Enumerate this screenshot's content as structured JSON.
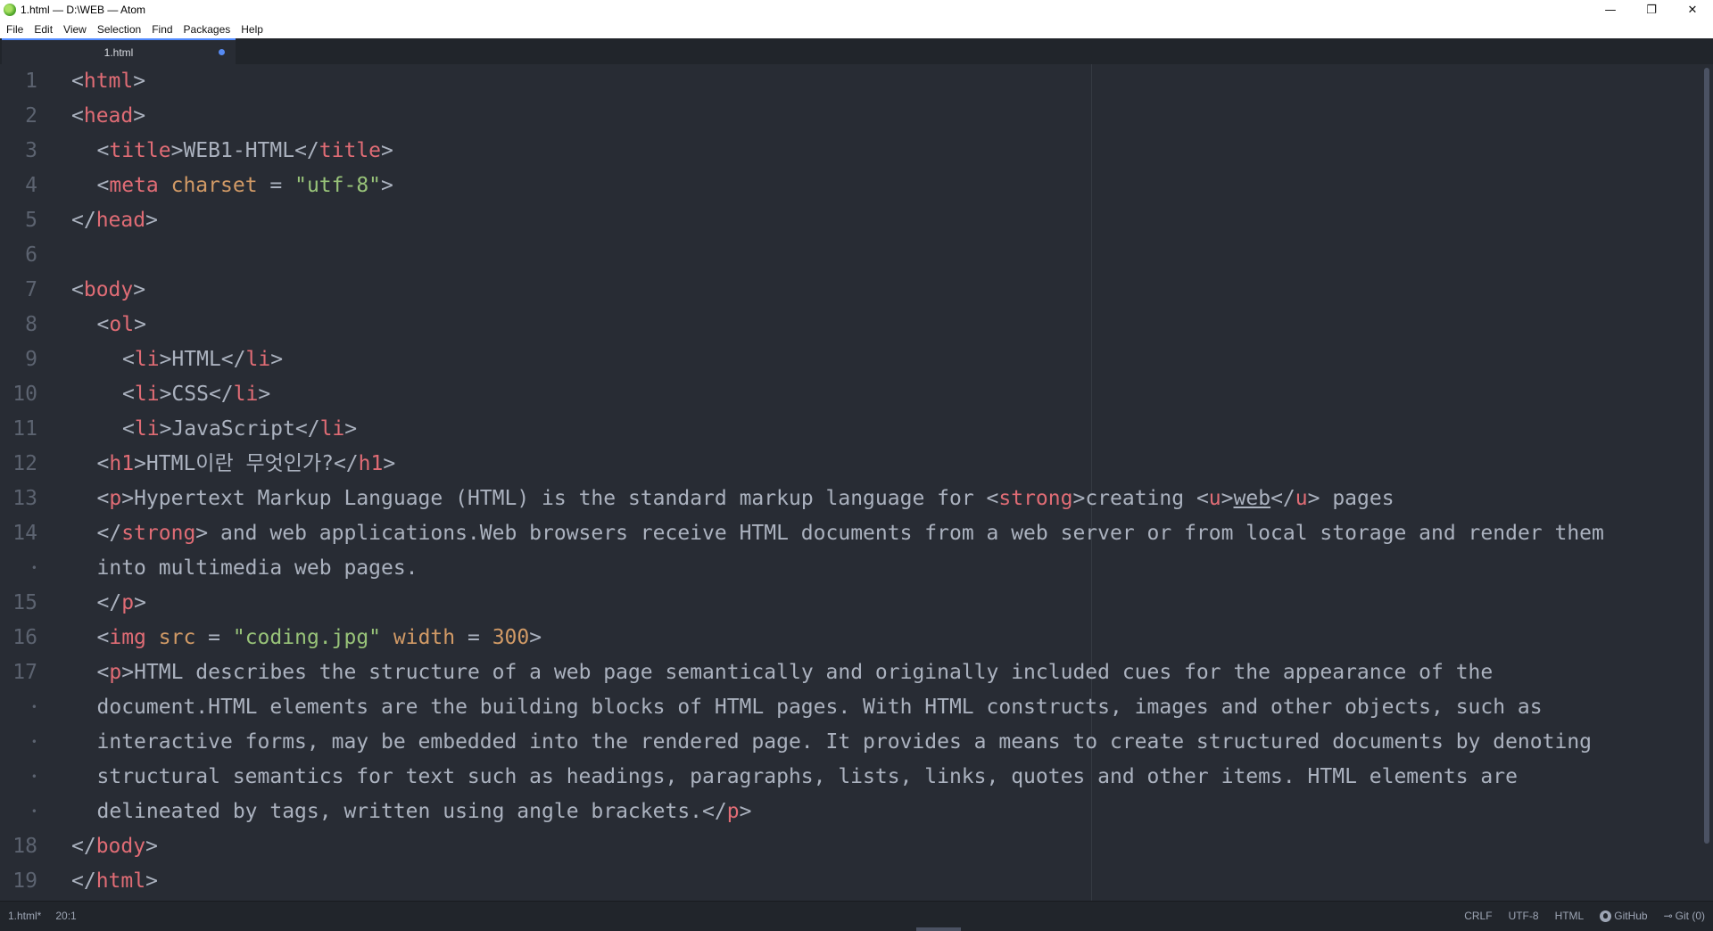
{
  "window": {
    "title": "1.html — D:\\WEB — Atom",
    "controls": {
      "minimize": "—",
      "restore": "❐",
      "close": "✕"
    }
  },
  "menu": [
    "File",
    "Edit",
    "View",
    "Selection",
    "Find",
    "Packages",
    "Help"
  ],
  "tabs": [
    {
      "label": "1.html",
      "modified": true
    }
  ],
  "editor": {
    "lines": [
      {
        "gutter": "1",
        "indent": 0,
        "tokens": [
          [
            "p",
            "<"
          ],
          [
            "tag",
            "html"
          ],
          [
            "p",
            ">"
          ]
        ]
      },
      {
        "gutter": "2",
        "indent": 0,
        "tokens": [
          [
            "p",
            "<"
          ],
          [
            "tag",
            "head"
          ],
          [
            "p",
            ">"
          ]
        ]
      },
      {
        "gutter": "3",
        "indent": 1,
        "tokens": [
          [
            "p",
            "<"
          ],
          [
            "tag",
            "title"
          ],
          [
            "p",
            ">WEB1-HTML</"
          ],
          [
            "tag",
            "title"
          ],
          [
            "p",
            ">"
          ]
        ]
      },
      {
        "gutter": "4",
        "indent": 1,
        "tokens": [
          [
            "p",
            "<"
          ],
          [
            "tag",
            "meta"
          ],
          [
            "p",
            " "
          ],
          [
            "attr",
            "charset"
          ],
          [
            "p",
            " = "
          ],
          [
            "str",
            "\"utf-8\""
          ],
          [
            "p",
            ">"
          ]
        ]
      },
      {
        "gutter": "5",
        "indent": 0,
        "tokens": [
          [
            "p",
            "</"
          ],
          [
            "tag",
            "head"
          ],
          [
            "p",
            ">"
          ]
        ]
      },
      {
        "gutter": "6",
        "indent": 0,
        "tokens": []
      },
      {
        "gutter": "7",
        "indent": 0,
        "tokens": [
          [
            "p",
            "<"
          ],
          [
            "tag",
            "body"
          ],
          [
            "p",
            ">"
          ]
        ]
      },
      {
        "gutter": "8",
        "indent": 1,
        "tokens": [
          [
            "p",
            "<"
          ],
          [
            "tag",
            "ol"
          ],
          [
            "p",
            ">"
          ]
        ]
      },
      {
        "gutter": "9",
        "indent": 2,
        "tokens": [
          [
            "p",
            "<"
          ],
          [
            "tag",
            "li"
          ],
          [
            "p",
            ">HTML</"
          ],
          [
            "tag",
            "li"
          ],
          [
            "p",
            ">"
          ]
        ]
      },
      {
        "gutter": "10",
        "indent": 2,
        "tokens": [
          [
            "p",
            "<"
          ],
          [
            "tag",
            "li"
          ],
          [
            "p",
            ">CSS</"
          ],
          [
            "tag",
            "li"
          ],
          [
            "p",
            ">"
          ]
        ]
      },
      {
        "gutter": "11",
        "indent": 2,
        "tokens": [
          [
            "p",
            "<"
          ],
          [
            "tag",
            "li"
          ],
          [
            "p",
            ">JavaScript</"
          ],
          [
            "tag",
            "li"
          ],
          [
            "p",
            ">"
          ]
        ]
      },
      {
        "gutter": "12",
        "indent": 1,
        "tokens": [
          [
            "p",
            "<"
          ],
          [
            "tag",
            "h1"
          ],
          [
            "p",
            ">HTML이란 무엇인가?</"
          ],
          [
            "tag",
            "h1"
          ],
          [
            "p",
            ">"
          ]
        ]
      },
      {
        "gutter": "13",
        "indent": 1,
        "tokens": [
          [
            "p",
            "<"
          ],
          [
            "tag",
            "p"
          ],
          [
            "p",
            ">Hypertext Markup Language (HTML) is the standard markup language for <"
          ],
          [
            "tag",
            "strong"
          ],
          [
            "p",
            ">creating <"
          ],
          [
            "tag",
            "u"
          ],
          [
            "p",
            ">"
          ],
          [
            "under",
            "web"
          ],
          [
            "p",
            "</"
          ],
          [
            "tag",
            "u"
          ],
          [
            "p",
            "> pages"
          ]
        ]
      },
      {
        "gutter": "14",
        "indent": 1,
        "tokens": [
          [
            "p",
            "</"
          ],
          [
            "tag",
            "strong"
          ],
          [
            "p",
            "> and web applications.Web browsers receive HTML documents from a web server or from local storage and render them"
          ]
        ]
      },
      {
        "gutter": "•",
        "indent": 1,
        "tokens": [
          [
            "p",
            "into multimedia web pages."
          ]
        ]
      },
      {
        "gutter": "15",
        "indent": 1,
        "tokens": [
          [
            "p",
            "</"
          ],
          [
            "tag",
            "p"
          ],
          [
            "p",
            ">"
          ]
        ]
      },
      {
        "gutter": "16",
        "indent": 1,
        "tokens": [
          [
            "p",
            "<"
          ],
          [
            "tag",
            "img"
          ],
          [
            "p",
            " "
          ],
          [
            "attr",
            "src"
          ],
          [
            "p",
            " = "
          ],
          [
            "str",
            "\"coding.jpg\""
          ],
          [
            "p",
            " "
          ],
          [
            "attr",
            "width"
          ],
          [
            "p",
            " = "
          ],
          [
            "num",
            "300"
          ],
          [
            "p",
            ">"
          ]
        ]
      },
      {
        "gutter": "17",
        "indent": 1,
        "tokens": [
          [
            "p",
            "<"
          ],
          [
            "tag",
            "p"
          ],
          [
            "p",
            ">HTML describes the structure of a web page semantically and originally included cues for the appearance of the"
          ]
        ]
      },
      {
        "gutter": "•",
        "indent": 1,
        "tokens": [
          [
            "p",
            "document.HTML elements are the building blocks of HTML pages. With HTML constructs, images and other objects, such as"
          ]
        ]
      },
      {
        "gutter": "•",
        "indent": 1,
        "tokens": [
          [
            "p",
            "interactive forms, may be embedded into the rendered page. It provides a means to create structured documents by denoting"
          ]
        ]
      },
      {
        "gutter": "•",
        "indent": 1,
        "tokens": [
          [
            "p",
            "structural semantics for text such as headings, paragraphs, lists, links, quotes and other items. HTML elements are"
          ]
        ]
      },
      {
        "gutter": "•",
        "indent": 1,
        "tokens": [
          [
            "p",
            "delineated by tags, written using angle brackets.</"
          ],
          [
            "tag",
            "p"
          ],
          [
            "p",
            ">"
          ]
        ]
      },
      {
        "gutter": "18",
        "indent": 0,
        "tokens": [
          [
            "p",
            "</"
          ],
          [
            "tag",
            "body"
          ],
          [
            "p",
            ">"
          ]
        ]
      },
      {
        "gutter": "19",
        "indent": 0,
        "tokens": [
          [
            "p",
            "</"
          ],
          [
            "tag",
            "html"
          ],
          [
            "p",
            ">"
          ]
        ]
      }
    ]
  },
  "status": {
    "file": "1.html*",
    "cursor": "20:1",
    "line_ending": "CRLF",
    "encoding": "UTF-8",
    "grammar": "HTML",
    "github": "GitHub",
    "git": "Git (0)"
  },
  "colors": {
    "background": "#282c34",
    "tag": "#e06c75",
    "attribute": "#d19a66",
    "string": "#98c379",
    "text": "#abb2bf",
    "gutter": "#5c6370",
    "accent": "#528bff"
  }
}
